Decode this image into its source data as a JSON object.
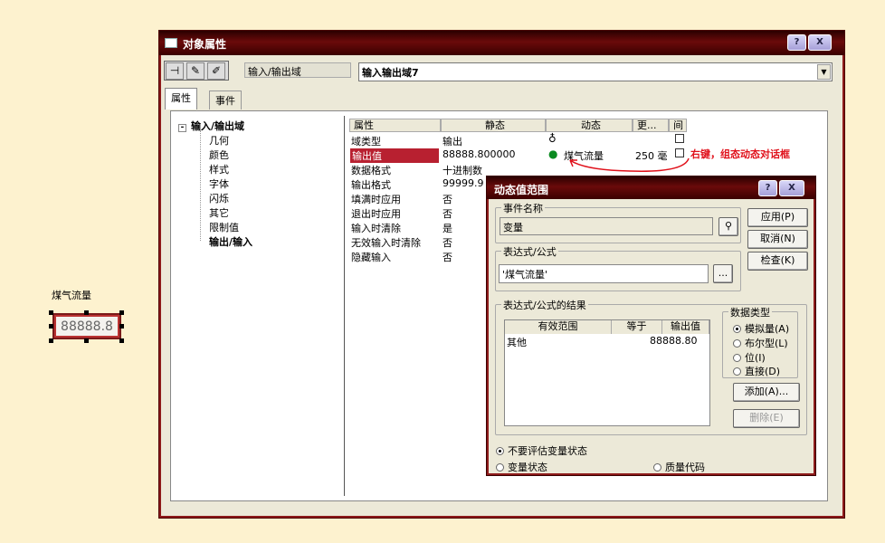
{
  "canvas": {
    "label": "煤气流量",
    "io_value": "88888.8"
  },
  "main": {
    "title": "对象属性",
    "help_btn": "?",
    "close_btn": "X",
    "object_type": "输入/输出域",
    "object_name": "输入输出域7",
    "tabs": [
      "属性",
      "事件"
    ],
    "tree": {
      "root": "输入/输出域",
      "items": [
        "几何",
        "颜色",
        "样式",
        "字体",
        "闪烁",
        "其它",
        "限制值",
        "输出/输入"
      ]
    },
    "grid": {
      "headers": [
        "属性",
        "静态",
        "动态",
        "更...",
        "间"
      ],
      "rows": [
        {
          "prop": "域类型",
          "static": "输出"
        },
        {
          "prop": "输出值",
          "static": "88888.800000",
          "dynamic": "煤气流量",
          "update": "250 毫:"
        },
        {
          "prop": "数据格式",
          "static": "十进制数"
        },
        {
          "prop": "输出格式",
          "static": "99999.9"
        },
        {
          "prop": "填满时应用",
          "static": "否"
        },
        {
          "prop": "退出时应用",
          "static": "否"
        },
        {
          "prop": "输入时清除",
          "static": "是"
        },
        {
          "prop": "无效输入时清除",
          "static": "否"
        },
        {
          "prop": "隐藏输入",
          "static": "否"
        }
      ]
    },
    "annotation": "右键，组态动态对话框"
  },
  "dialog": {
    "title": "动态值范围",
    "help_btn": "?",
    "close_btn": "X",
    "event_group": "事件名称",
    "event_value": "变量",
    "expr_group": "表达式/公式",
    "expr_value": "'煤气流量'",
    "browse": "...",
    "result_group": "表达式/公式的结果",
    "result_headers": [
      "有效范围",
      "等于",
      "输出值"
    ],
    "result_rows": [
      {
        "range": "其他",
        "value": "88888.80"
      }
    ],
    "datatype_group": "数据类型",
    "datatypes": [
      "模拟量(A)",
      "布尔型(L)",
      "位(I)",
      "直接(D)"
    ],
    "btn_apply": "应用(P)",
    "btn_cancel": "取消(N)",
    "btn_check": "检查(K)",
    "btn_add": "添加(A)...",
    "btn_delete": "删除(E)",
    "eval_opts": [
      "不要评估变量状态",
      "变量状态",
      "质量代码"
    ]
  }
}
